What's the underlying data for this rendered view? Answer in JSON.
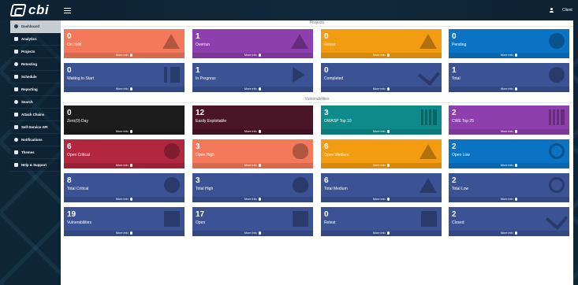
{
  "app": {
    "logo_text": "cbi",
    "user_label": "Client"
  },
  "sidebar": {
    "items": [
      {
        "label": "Dashboard",
        "active": true,
        "icon": "dashboard-icon"
      },
      {
        "label": "Analytics",
        "active": false,
        "icon": "analytics-icon"
      },
      {
        "label": "Projects",
        "active": false,
        "icon": "projects-icon"
      },
      {
        "label": "Retesting",
        "active": false,
        "icon": "check-icon"
      },
      {
        "label": "Schedule",
        "active": false,
        "icon": "calendar-icon"
      },
      {
        "label": "Reporting",
        "active": false,
        "icon": "report-icon"
      },
      {
        "label": "Search",
        "active": false,
        "icon": "search-icon"
      },
      {
        "label": "Attack Chains",
        "active": false,
        "icon": "chain-icon"
      },
      {
        "label": "Self-Service API",
        "active": false,
        "icon": "api-icon"
      },
      {
        "label": "Notifications",
        "active": false,
        "icon": "bell-icon"
      },
      {
        "label": "Themes",
        "active": false,
        "icon": "brush-icon"
      },
      {
        "label": "Help & Support",
        "active": false,
        "icon": "help-icon"
      }
    ]
  },
  "sections": {
    "projects_title": "Projects",
    "vulnerabilities_title": "Vulnerabilities"
  },
  "more_info_label": "More info",
  "projects": [
    {
      "value": "0",
      "label": "On Hold",
      "color": "#f4795b",
      "icon": "warning-icon"
    },
    {
      "value": "1",
      "label": "Overrun",
      "color": "#8e3fae",
      "icon": "warning-icon"
    },
    {
      "value": "0",
      "label": "Retest",
      "color": "#f39c12",
      "icon": "warning-icon"
    },
    {
      "value": "0",
      "label": "Pending",
      "color": "#0b73c4",
      "icon": "info-icon"
    },
    {
      "value": "0",
      "label": "Waiting to Start",
      "color": "#3b5395",
      "icon": "pause-icon"
    },
    {
      "value": "1",
      "label": "In Progress",
      "color": "#3b5395",
      "icon": "play-icon"
    },
    {
      "value": "0",
      "label": "Completed",
      "color": "#3b5395",
      "icon": "check-icon"
    },
    {
      "value": "1",
      "label": "Total",
      "color": "#3b5395",
      "icon": "info-icon"
    }
  ],
  "vulnerabilities": [
    {
      "value": "0",
      "label": "Zero(0)-Day",
      "color": "#1c1c1c",
      "icon": "none"
    },
    {
      "value": "12",
      "label": "Easily Exploitable",
      "color": "#4a1526",
      "icon": "none"
    },
    {
      "value": "3",
      "label": "OWASP Top 10",
      "color": "#0f8a8a",
      "icon": "bars-icon"
    },
    {
      "value": "2",
      "label": "CWE Top 25",
      "color": "#8e3fae",
      "icon": "bars-icon"
    },
    {
      "value": "6",
      "label": "Open Critical",
      "color": "#b0273f",
      "icon": "radiation-icon"
    },
    {
      "value": "3",
      "label": "Open High",
      "color": "#f4795b",
      "icon": "flame-icon"
    },
    {
      "value": "6",
      "label": "Open Medium",
      "color": "#f39c12",
      "icon": "warning-icon"
    },
    {
      "value": "2",
      "label": "Open Low",
      "color": "#0b73c4",
      "icon": "eye-icon"
    },
    {
      "value": "8",
      "label": "Total Critical",
      "color": "#3b5395",
      "icon": "radiation-icon"
    },
    {
      "value": "3",
      "label": "Total High",
      "color": "#3b5395",
      "icon": "flame-icon"
    },
    {
      "value": "6",
      "label": "Total Medium",
      "color": "#3b5395",
      "icon": "warning-icon"
    },
    {
      "value": "2",
      "label": "Total Low",
      "color": "#3b5395",
      "icon": "eye-icon"
    },
    {
      "value": "19",
      "label": "Vulnerabilities",
      "color": "#3b5395",
      "icon": "flag-icon"
    },
    {
      "value": "17",
      "label": "Open",
      "color": "#3b5395",
      "icon": "flag-icon"
    },
    {
      "value": "0",
      "label": "Retest",
      "color": "#3b5395",
      "icon": "flag-icon"
    },
    {
      "value": "2",
      "label": "Closed",
      "color": "#3b5395",
      "icon": "check-icon"
    }
  ]
}
